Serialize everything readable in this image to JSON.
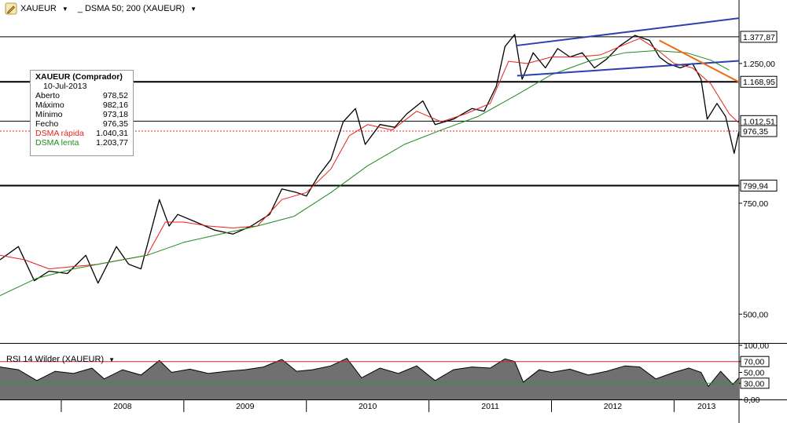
{
  "toolbar": {
    "symbol": "XAUEUR",
    "indicator": "_ DSMA 50; 200 (XAUEUR)"
  },
  "info_box": {
    "title": "XAUEUR (Comprador)",
    "date": "10-Jul-2013",
    "rows": [
      {
        "label": "Aberto",
        "value": "978,52",
        "color": "#000000"
      },
      {
        "label": "Máximo",
        "value": "982,16",
        "color": "#000000"
      },
      {
        "label": "Mínimo",
        "value": "973,18",
        "color": "#000000"
      },
      {
        "label": "Fecho",
        "value": "976,35",
        "color": "#000000"
      },
      {
        "label": "DSMA rápida",
        "value": "1.040,31",
        "color": "#e8201c"
      },
      {
        "label": "DSMA lenta",
        "value": "1.203,77",
        "color": "#1d8a1d"
      }
    ]
  },
  "rsi_title": "RSI 14 Wilder (XAUEUR)",
  "colors": {
    "price": "#000000",
    "fast_ma": "#e8201c",
    "slow_ma": "#1d8a1d",
    "channel": "#2b3fb0",
    "trendline": "#ee6a12",
    "rsi_fill": "#707070",
    "rsi_upper": "#d0203a",
    "rsi_lower": "#2a9a2a"
  },
  "chart_data": [
    {
      "type": "line",
      "name": "price",
      "y_scale": "log",
      "ylim": [
        450,
        1480
      ],
      "y_ticks": [
        {
          "value": 500,
          "label": "500,00"
        },
        {
          "value": 750,
          "label": "750,00"
        },
        {
          "value": 1250,
          "label": "1.250,00"
        }
      ],
      "price_levels": [
        {
          "value": 1377.87,
          "label": "1.377,87",
          "line": "solid"
        },
        {
          "value": 1168.95,
          "label": "1.168,95",
          "line": "solid-bold"
        },
        {
          "value": 1012.51,
          "label": "1.012,51",
          "line": "solid"
        },
        {
          "value": 976.35,
          "label": "976,35",
          "line": "dotted-red"
        },
        {
          "value": 799.94,
          "label": "799,94",
          "line": "solid-bold"
        }
      ],
      "x_labels": [
        "2008",
        "2009",
        "2010",
        "2011",
        "2012",
        "2013"
      ],
      "x_range": [
        2007.5,
        2013.53
      ],
      "series": [
        {
          "key": "price",
          "points": [
            [
              2007.5,
              610
            ],
            [
              2007.65,
              640
            ],
            [
              2007.78,
              565
            ],
            [
              2007.9,
              585
            ],
            [
              2008.05,
              580
            ],
            [
              2008.2,
              620
            ],
            [
              2008.3,
              560
            ],
            [
              2008.45,
              640
            ],
            [
              2008.55,
              600
            ],
            [
              2008.65,
              590
            ],
            [
              2008.8,
              760
            ],
            [
              2008.88,
              690
            ],
            [
              2008.95,
              720
            ],
            [
              2009.1,
              700
            ],
            [
              2009.25,
              680
            ],
            [
              2009.4,
              670
            ],
            [
              2009.55,
              690
            ],
            [
              2009.7,
              720
            ],
            [
              2009.8,
              790
            ],
            [
              2009.92,
              780
            ],
            [
              2010.0,
              770
            ],
            [
              2010.1,
              830
            ],
            [
              2010.2,
              880
            ],
            [
              2010.3,
              1010
            ],
            [
              2010.4,
              1060
            ],
            [
              2010.48,
              930
            ],
            [
              2010.6,
              1000
            ],
            [
              2010.72,
              990
            ],
            [
              2010.82,
              1040
            ],
            [
              2010.95,
              1090
            ],
            [
              2011.05,
              1000
            ],
            [
              2011.2,
              1020
            ],
            [
              2011.35,
              1060
            ],
            [
              2011.45,
              1050
            ],
            [
              2011.55,
              1150
            ],
            [
              2011.62,
              1330
            ],
            [
              2011.7,
              1390
            ],
            [
              2011.76,
              1180
            ],
            [
              2011.85,
              1300
            ],
            [
              2011.95,
              1230
            ],
            [
              2012.05,
              1320
            ],
            [
              2012.15,
              1280
            ],
            [
              2012.25,
              1300
            ],
            [
              2012.35,
              1230
            ],
            [
              2012.45,
              1270
            ],
            [
              2012.55,
              1330
            ],
            [
              2012.68,
              1385
            ],
            [
              2012.8,
              1360
            ],
            [
              2012.88,
              1280
            ],
            [
              2012.95,
              1250
            ],
            [
              2013.05,
              1230
            ],
            [
              2013.15,
              1250
            ],
            [
              2013.22,
              1180
            ],
            [
              2013.27,
              1020
            ],
            [
              2013.35,
              1080
            ],
            [
              2013.42,
              1030
            ],
            [
              2013.49,
              900
            ],
            [
              2013.53,
              976
            ]
          ]
        },
        {
          "key": "fast_ma",
          "points": [
            [
              2007.5,
              620
            ],
            [
              2007.7,
              610
            ],
            [
              2007.9,
              590
            ],
            [
              2008.1,
              595
            ],
            [
              2008.3,
              600
            ],
            [
              2008.5,
              610
            ],
            [
              2008.7,
              620
            ],
            [
              2008.85,
              700
            ],
            [
              2009.0,
              700
            ],
            [
              2009.2,
              690
            ],
            [
              2009.4,
              685
            ],
            [
              2009.6,
              690
            ],
            [
              2009.8,
              760
            ],
            [
              2010.0,
              780
            ],
            [
              2010.2,
              850
            ],
            [
              2010.35,
              960
            ],
            [
              2010.5,
              1000
            ],
            [
              2010.7,
              980
            ],
            [
              2010.9,
              1050
            ],
            [
              2011.1,
              1010
            ],
            [
              2011.3,
              1040
            ],
            [
              2011.5,
              1080
            ],
            [
              2011.65,
              1260
            ],
            [
              2011.8,
              1250
            ],
            [
              2012.0,
              1280
            ],
            [
              2012.2,
              1280
            ],
            [
              2012.4,
              1290
            ],
            [
              2012.6,
              1340
            ],
            [
              2012.72,
              1370
            ],
            [
              2012.85,
              1320
            ],
            [
              2013.0,
              1250
            ],
            [
              2013.15,
              1230
            ],
            [
              2013.3,
              1160
            ],
            [
              2013.45,
              1040
            ],
            [
              2013.53,
              1005
            ]
          ]
        },
        {
          "key": "slow_ma",
          "points": [
            [
              2007.5,
              535
            ],
            [
              2007.8,
              570
            ],
            [
              2008.1,
              590
            ],
            [
              2008.4,
              605
            ],
            [
              2008.7,
              620
            ],
            [
              2009.0,
              650
            ],
            [
              2009.3,
              670
            ],
            [
              2009.6,
              690
            ],
            [
              2009.9,
              715
            ],
            [
              2010.2,
              780
            ],
            [
              2010.5,
              860
            ],
            [
              2010.8,
              930
            ],
            [
              2011.1,
              980
            ],
            [
              2011.4,
              1030
            ],
            [
              2011.7,
              1110
            ],
            [
              2012.0,
              1200
            ],
            [
              2012.3,
              1260
            ],
            [
              2012.6,
              1300
            ],
            [
              2012.85,
              1310
            ],
            [
              2013.1,
              1300
            ],
            [
              2013.3,
              1265
            ],
            [
              2013.45,
              1220
            ]
          ]
        }
      ],
      "annotations": [
        {
          "key": "channel",
          "from": [
            2011.72,
            1195
          ],
          "to": [
            2013.53,
            1262
          ]
        },
        {
          "key": "channel",
          "from": [
            2011.72,
            1335
          ],
          "to": [
            2013.53,
            1475
          ]
        },
        {
          "key": "trendline",
          "from": [
            2012.88,
            1360
          ],
          "to": [
            2013.53,
            1168
          ]
        }
      ]
    },
    {
      "type": "area",
      "name": "rsi",
      "ylim": [
        0,
        100
      ],
      "y_ticks": [
        {
          "value": 100,
          "label": "100,00"
        },
        {
          "value": 70,
          "label": "70,00"
        },
        {
          "value": 50,
          "label": "50,00"
        },
        {
          "value": 30,
          "label": "30,00"
        },
        {
          "value": 0,
          "label": "0,00"
        }
      ],
      "bands": [
        70,
        30
      ],
      "series": [
        {
          "key": "rsi",
          "points": [
            [
              2007.5,
              60
            ],
            [
              2007.65,
              55
            ],
            [
              2007.8,
              35
            ],
            [
              2007.95,
              52
            ],
            [
              2008.1,
              48
            ],
            [
              2008.25,
              58
            ],
            [
              2008.35,
              38
            ],
            [
              2008.5,
              55
            ],
            [
              2008.65,
              45
            ],
            [
              2008.8,
              72
            ],
            [
              2008.9,
              50
            ],
            [
              2009.05,
              56
            ],
            [
              2009.2,
              48
            ],
            [
              2009.35,
              52
            ],
            [
              2009.5,
              55
            ],
            [
              2009.65,
              60
            ],
            [
              2009.8,
              74
            ],
            [
              2009.92,
              52
            ],
            [
              2010.05,
              55
            ],
            [
              2010.2,
              62
            ],
            [
              2010.33,
              76
            ],
            [
              2010.45,
              40
            ],
            [
              2010.6,
              58
            ],
            [
              2010.75,
              48
            ],
            [
              2010.9,
              62
            ],
            [
              2011.05,
              35
            ],
            [
              2011.2,
              55
            ],
            [
              2011.35,
              60
            ],
            [
              2011.5,
              58
            ],
            [
              2011.62,
              75
            ],
            [
              2011.7,
              70
            ],
            [
              2011.77,
              32
            ],
            [
              2011.9,
              55
            ],
            [
              2012.0,
              50
            ],
            [
              2012.15,
              56
            ],
            [
              2012.3,
              45
            ],
            [
              2012.45,
              52
            ],
            [
              2012.6,
              62
            ],
            [
              2012.72,
              60
            ],
            [
              2012.85,
              38
            ],
            [
              2013.0,
              50
            ],
            [
              2013.12,
              58
            ],
            [
              2013.22,
              50
            ],
            [
              2013.28,
              24
            ],
            [
              2013.38,
              52
            ],
            [
              2013.48,
              28
            ],
            [
              2013.53,
              40
            ]
          ]
        }
      ]
    }
  ]
}
